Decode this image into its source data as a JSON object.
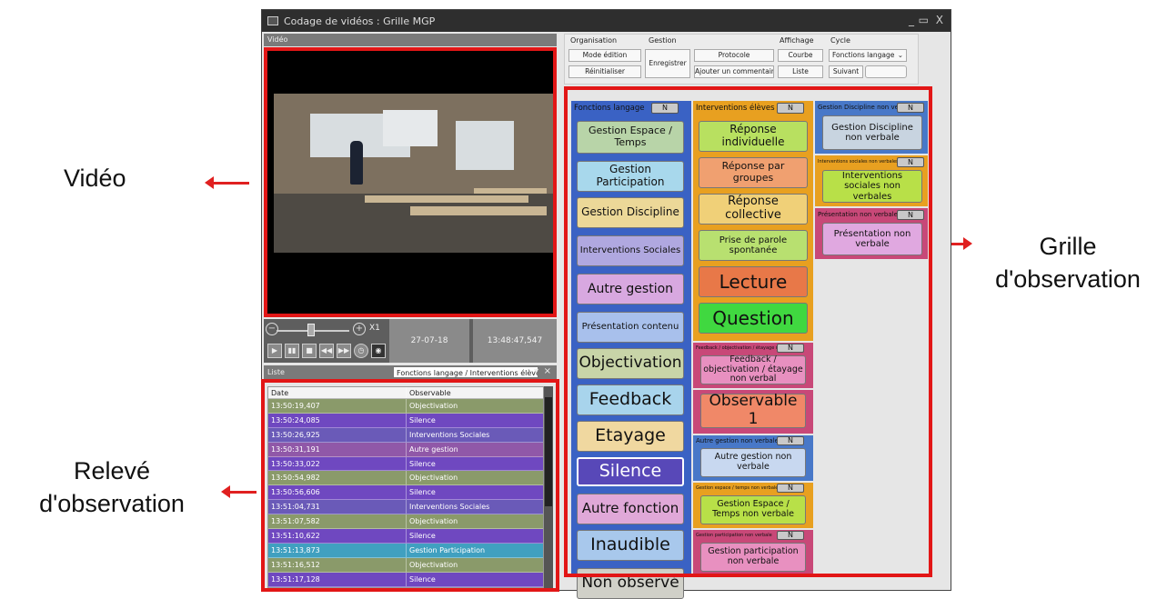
{
  "callouts": {
    "video": "Vidéo",
    "releve_line1": "Relevé",
    "releve_line2": "d'observation",
    "grille_line1": "Grille",
    "grille_line2": "d'observation"
  },
  "window": {
    "title": "Codage de vidéos : Grille MGP",
    "controls": [
      "_",
      "▭",
      "X"
    ]
  },
  "video_panel": {
    "header": "Vidéo"
  },
  "player": {
    "speed": "X1",
    "date": "27-07-18",
    "time": "13:48:47,547"
  },
  "list_panel": {
    "header": "Liste",
    "filter_value": "Fonctions langage / Interventions élève",
    "columns": [
      "Date",
      "Observable"
    ],
    "rows": [
      {
        "date": "13:50:19,407",
        "observable": "Objectivation",
        "color": "#8a9a6a"
      },
      {
        "date": "13:50:24,085",
        "observable": "Silence",
        "color": "#6f48c0"
      },
      {
        "date": "13:50:26,925",
        "observable": "Interventions Sociales",
        "color": "#6a5ab8"
      },
      {
        "date": "13:50:31,191",
        "observable": "Autre gestion",
        "color": "#9058a8"
      },
      {
        "date": "13:50:33,022",
        "observable": "Silence",
        "color": "#6f48c0"
      },
      {
        "date": "13:50:54,982",
        "observable": "Objectivation",
        "color": "#8a9a6a"
      },
      {
        "date": "13:50:56,606",
        "observable": "Silence",
        "color": "#6f48c0"
      },
      {
        "date": "13:51:04,731",
        "observable": "Interventions Sociales",
        "color": "#6a5ab8"
      },
      {
        "date": "13:51:07,582",
        "observable": "Objectivation",
        "color": "#8a9a6a"
      },
      {
        "date": "13:51:10,622",
        "observable": "Silence",
        "color": "#6f48c0"
      },
      {
        "date": "13:51:13,873",
        "observable": "Gestion Participation",
        "color": "#40a0c0"
      },
      {
        "date": "13:51:16,512",
        "observable": "Objectivation",
        "color": "#8a9a6a"
      },
      {
        "date": "13:51:17,128",
        "observable": "Silence",
        "color": "#6f48c0"
      }
    ]
  },
  "ribbon": {
    "groups": {
      "organisation": "Organisation",
      "gestion": "Gestion",
      "affichage": "Affichage",
      "cycle": "Cycle"
    },
    "buttons": {
      "mode_edition": "Mode édition",
      "reinitialiser": "Réinitialiser",
      "enregistrer": "Enregistrer",
      "protocole": "Protocole",
      "ajouter_commentaire": "Ajouter un commentaire",
      "courbe": "Courbe",
      "liste": "Liste",
      "cycle_select": "Fonctions langage",
      "suivant": "Suivant"
    }
  },
  "observation_grid": {
    "col1": {
      "header": "Fonctions langage",
      "toggle": "N",
      "bg": "#3a62c4",
      "buttons": [
        {
          "label": "Gestion Espace / Temps",
          "bg": "#b8d4a8"
        },
        {
          "label": "Gestion Participation",
          "bg": "#a8d8ec"
        },
        {
          "label": "Gestion Discipline",
          "bg": "#ecd898"
        },
        {
          "label": "Interventions Sociales",
          "bg": "#b0a8e0"
        },
        {
          "label": "Autre gestion",
          "bg": "#d8a8e0"
        },
        {
          "label": "Présentation contenu",
          "bg": "#a8c0ec"
        },
        {
          "label": "Objectivation",
          "bg": "#c8d4a8"
        },
        {
          "label": "Feedback",
          "bg": "#a8d4ec"
        },
        {
          "label": "Etayage",
          "bg": "#f0d8a0"
        },
        {
          "label": "Silence",
          "bg": "#5848b8"
        },
        {
          "label": "Autre fonction",
          "bg": "#e0a8d8"
        },
        {
          "label": "Inaudible",
          "bg": "#a8c8ec"
        },
        {
          "label": "Non observé",
          "bg": "#d0d0c8"
        }
      ]
    },
    "col2": {
      "header": "Interventions élèves",
      "toggle": "N",
      "bg": "#e8a020",
      "buttons": [
        {
          "label": "Réponse individuelle",
          "bg": "#b8e060"
        },
        {
          "label": "Réponse par groupes",
          "bg": "#f0a070"
        },
        {
          "label": "Réponse collective",
          "bg": "#f0d078"
        },
        {
          "label": "Prise de parole spontanée",
          "bg": "#b8e070"
        },
        {
          "label": "Lecture",
          "bg": "#e87848"
        },
        {
          "label": "Question",
          "bg": "#40d840"
        }
      ],
      "sub": [
        {
          "header": "Feedback / objectivation / étayage non verbal",
          "bg": "#c84878",
          "button": "Feedback / objectivation / étayage non verbal",
          "button_bg": "#e890c0"
        },
        {
          "header": "",
          "bg": "#c84878",
          "button": "Observable 1",
          "button_bg": "#f08868"
        },
        {
          "header": "Autre gestion non verbale",
          "bg": "#4878c8",
          "button": "Autre gestion non verbale",
          "button_bg": "#c8d8f0"
        },
        {
          "header": "Gestion espace / temps non verbale",
          "bg": "#e8a020",
          "button": "Gestion Espace / Temps non verbale",
          "button_bg": "#b8e048"
        },
        {
          "header": "Gestion participation non verbale",
          "bg": "#c84878",
          "button": "Gestion participation non verbale",
          "button_bg": "#e890c0"
        }
      ]
    },
    "col3": {
      "blocks": [
        {
          "header": "Gestion Discipline non verbale",
          "bg": "#4878c8",
          "button": "Gestion Discipline non verbale",
          "button_bg": "#c8d4e0"
        },
        {
          "header": "Interventions sociales non verbales",
          "bg": "#e8a020",
          "button": "Interventions sociales non verbales",
          "button_bg": "#b8e048"
        },
        {
          "header": "Présentation non verbale",
          "bg": "#c84878",
          "button": "Présentation non verbale",
          "button_bg": "#e0a8e0"
        }
      ]
    }
  },
  "colors": {
    "highlight": "#e21616"
  }
}
